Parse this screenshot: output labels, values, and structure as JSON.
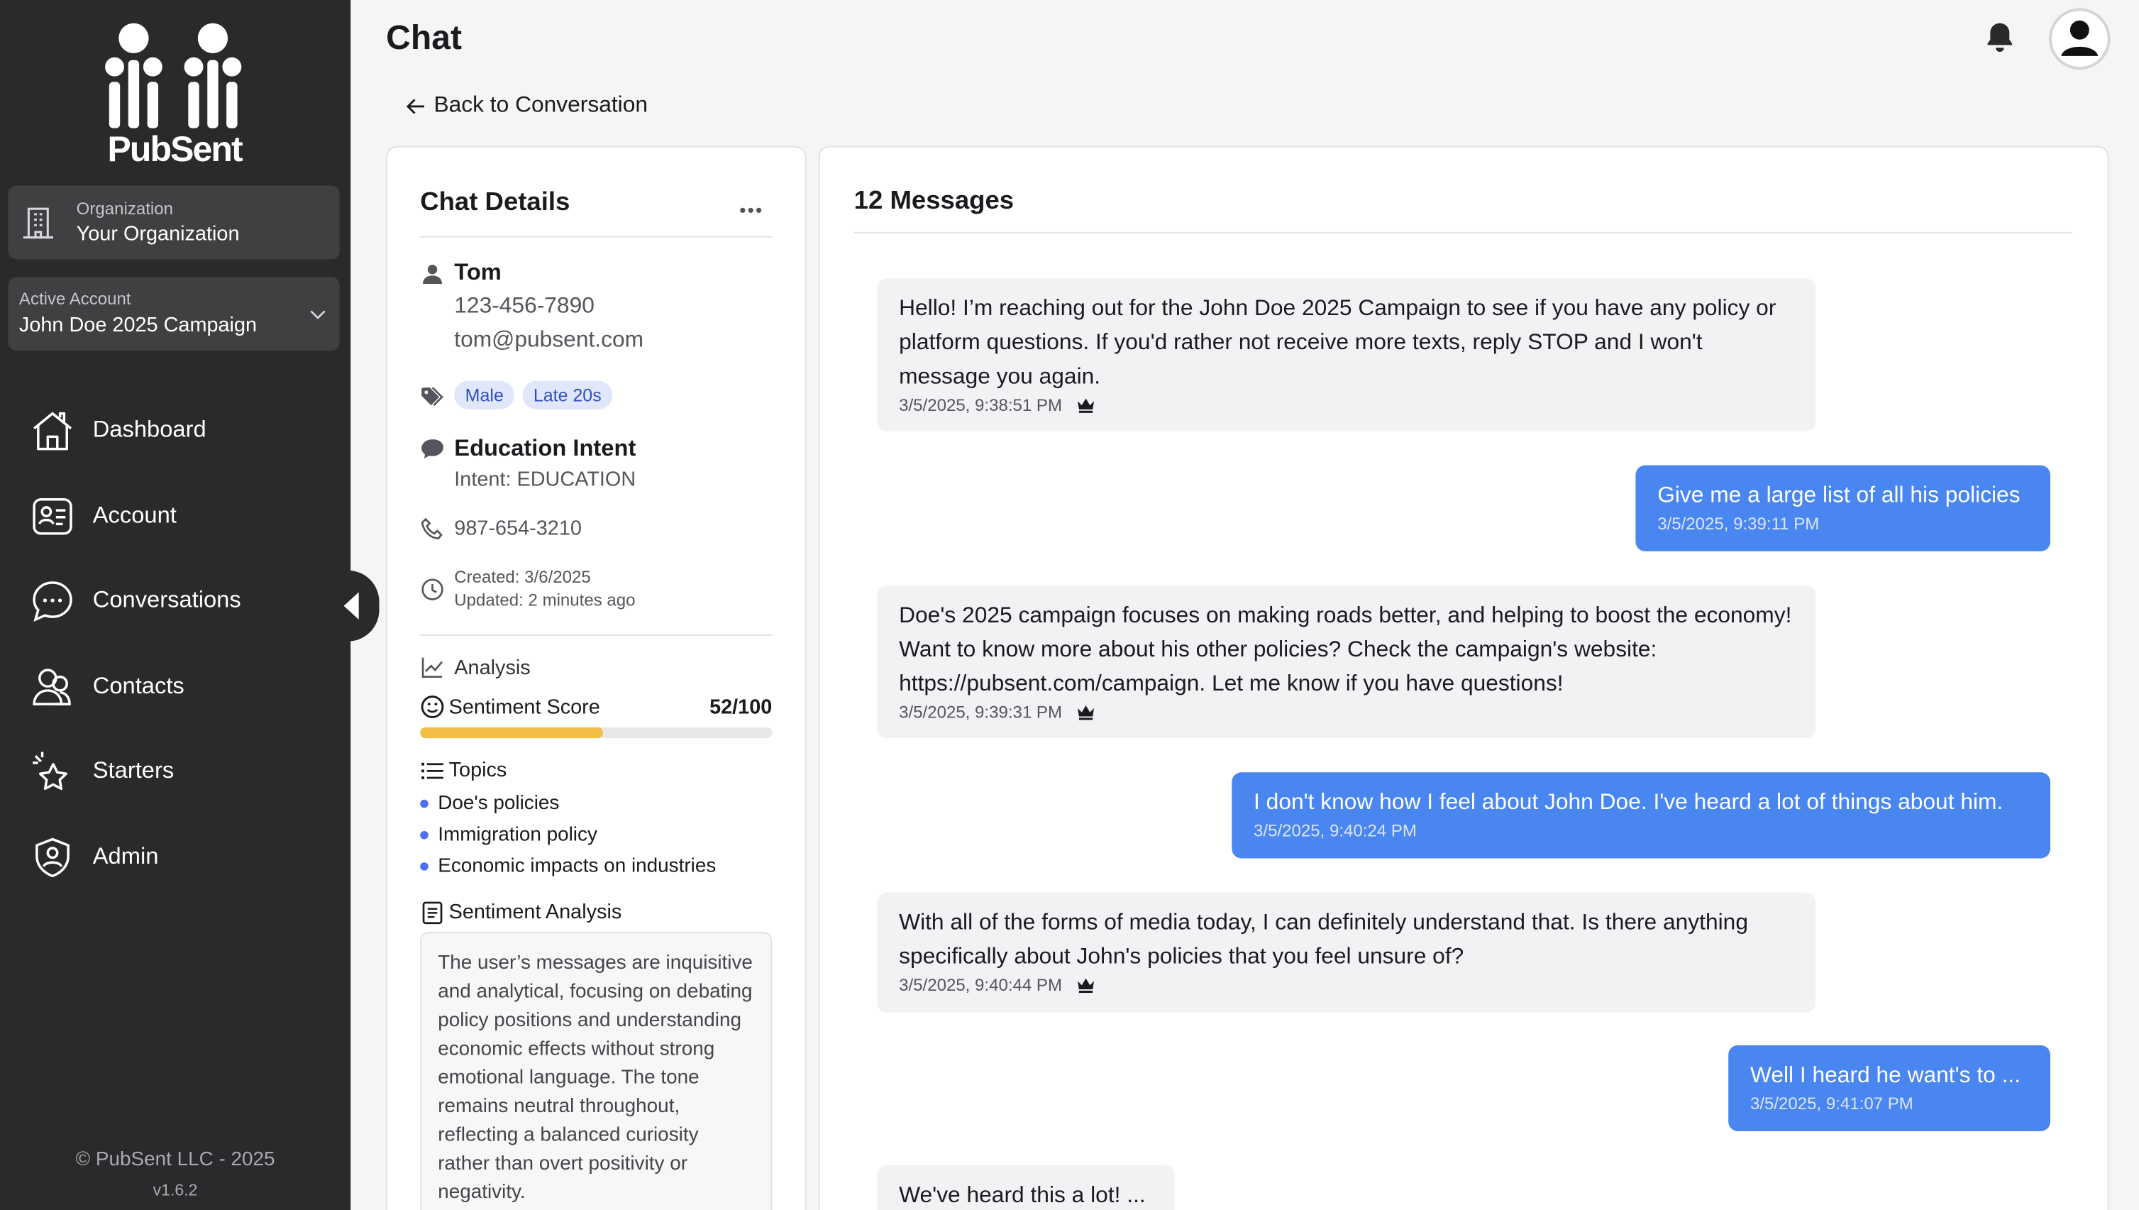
{
  "app": {
    "brand": "PubSent"
  },
  "sidebar": {
    "org_label": "Organization",
    "org_value": "Your Organization",
    "account_label": "Active Account",
    "account_value": "John Doe 2025 Campaign",
    "nav": [
      {
        "label": "Dashboard",
        "icon": "house-icon"
      },
      {
        "label": "Account",
        "icon": "id-card-icon"
      },
      {
        "label": "Conversations",
        "icon": "chat-bubble-icon"
      },
      {
        "label": "Contacts",
        "icon": "people-icon"
      },
      {
        "label": "Starters",
        "icon": "sparkle-star-icon"
      },
      {
        "label": "Admin",
        "icon": "shield-user-icon"
      }
    ],
    "footer": "© PubSent LLC - 2025",
    "version": "v1.6.2"
  },
  "header": {
    "title": "Chat",
    "back_label": "Back to Conversation"
  },
  "details": {
    "title": "Chat Details",
    "name": "Tom",
    "phone": "123-456-7890",
    "email": "tom@pubsent.com",
    "tags": [
      "Male",
      "Late 20s"
    ],
    "intent_title": "Education Intent",
    "intent_sub": "Intent: EDUCATION",
    "phone2": "987-654-3210",
    "created": "Created: 3/6/2025",
    "updated": "Updated: 2 minutes ago",
    "analysis_label": "Analysis",
    "sentiment_label": "Sentiment Score",
    "sentiment_score": "52/100",
    "sentiment_fraction": 0.52,
    "topics_label": "Topics",
    "topics": [
      "Doe's policies",
      "Immigration policy",
      "Economic impacts on industries"
    ],
    "sentiment_analysis_label": "Sentiment Analysis",
    "sentiment_analysis_text": "The user’s messages are inquisitive and analytical, focusing on debating policy positions and understanding economic effects without strong emotional language. The tone remains neutral throughout, reflecting a balanced curiosity rather than overt positivity or negativity."
  },
  "messages": {
    "count_label": "12 Messages",
    "items": [
      {
        "dir": "in",
        "text": "Hello! I’m reaching out for the John Doe 2025 Campaign to see if you have any policy or platform questions. If you'd rather not receive more texts, reply STOP and I won't message you again.",
        "time": "3/5/2025, 9:38:51 PM"
      },
      {
        "dir": "out",
        "text": "Give me a large list of all his policies",
        "time": "3/5/2025, 9:39:11 PM"
      },
      {
        "dir": "in",
        "text": "Doe's 2025 campaign focuses on making roads better, and helping to boost the economy! Want to know more about his other policies? Check the campaign's website: https://pubsent.com/campaign. Let me know if you have questions!",
        "time": "3/5/2025, 9:39:31 PM"
      },
      {
        "dir": "out",
        "text": "I don't know how I feel about John Doe. I've heard a lot of things about him.",
        "time": "3/5/2025, 9:40:24 PM"
      },
      {
        "dir": "in",
        "text": "With all of the forms of media today, I can definitely understand that. Is there anything specifically about John's policies that you feel unsure of?",
        "time": "3/5/2025, 9:40:44 PM"
      },
      {
        "dir": "out",
        "text": "Well I heard he want's to ...",
        "time": "3/5/2025, 9:41:07 PM"
      },
      {
        "dir": "in",
        "text": "We've heard this a lot! ...",
        "time": ""
      }
    ]
  }
}
